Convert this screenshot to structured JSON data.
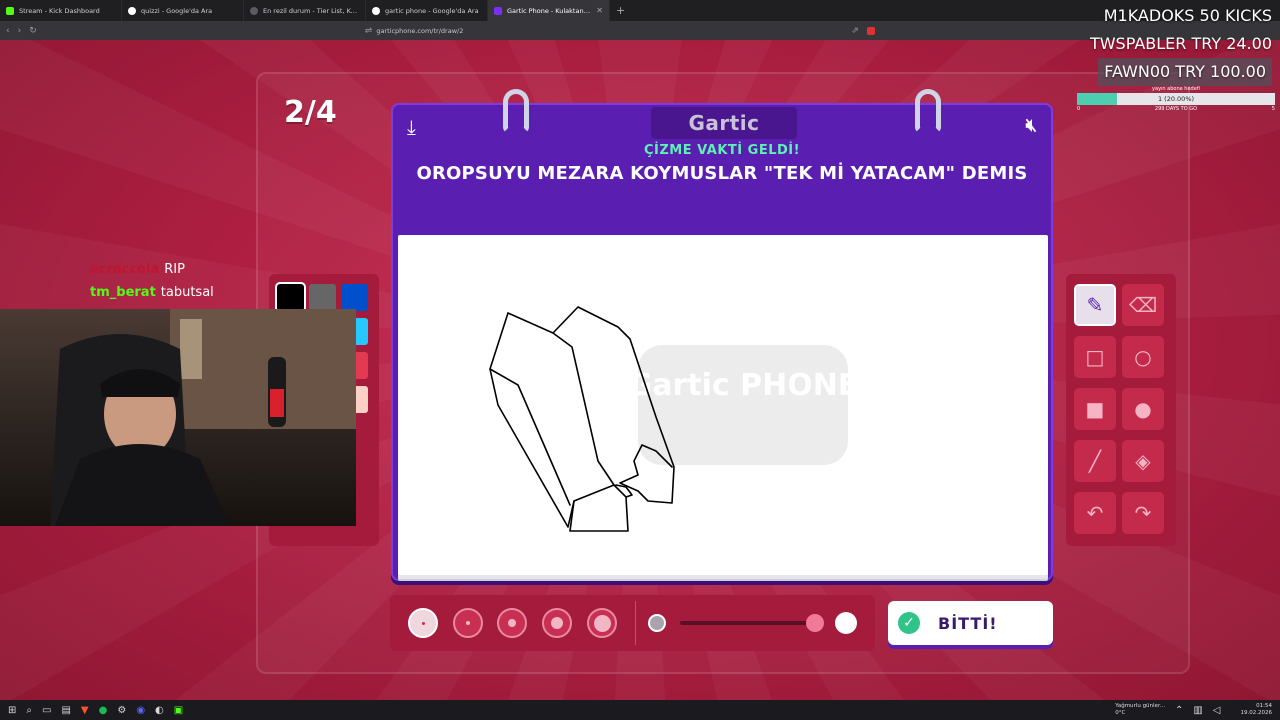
{
  "browser": {
    "tabs": [
      {
        "title": "Stream - Kick Dashboard",
        "icon": "kick-icon",
        "active": false
      },
      {
        "title": "quizzi - Google'da Ara",
        "icon": "google-icon",
        "active": false
      },
      {
        "title": "En rezil durum - Tier List, Kör Seale",
        "icon": "tier-icon",
        "active": false
      },
      {
        "title": "gartic phone - Google'da Ara",
        "icon": "google-icon",
        "active": false
      },
      {
        "title": "Gartic Phone - Kulaktan Kulağa",
        "icon": "gartic-icon",
        "active": true
      }
    ],
    "url": "garticphone.com/tr/draw/2"
  },
  "game": {
    "round": "2/4",
    "brand": "Gartic",
    "draw_time": "ÇİZME VAKTİ GELDİ!",
    "prompt": "OROPSUYU MEZARA KOYMUSLAR \"TEK Mİ YATACAM\" DEMIS",
    "done_label": "BİTTİ!",
    "watermark": "Gartic PHONE",
    "accent": "#5a1fb0",
    "palette": [
      "#000000",
      "#666666",
      "#0050cd",
      "#ffffff",
      "#aaaaaa",
      "#26c9ff",
      "#c0481a",
      "#ff7a00",
      "#e23a52",
      "#ff9a8a",
      "#e85f6a",
      "#fbd0c5"
    ],
    "selected_color": "#000000",
    "tools": [
      "pencil-icon",
      "eraser-icon",
      "rectangle-outline-icon",
      "circle-outline-icon",
      "rectangle-fill-icon",
      "circle-fill-icon",
      "line-icon",
      "fill-bucket-icon",
      "undo-icon",
      "redo-icon"
    ],
    "selected_tool": "pencil-icon",
    "brush_sizes": 5,
    "selected_size_index": 0
  },
  "overlay": {
    "chat": [
      {
        "user": "acraccola",
        "color": "#c01530",
        "message": "RIP"
      },
      {
        "user": "tm_berat",
        "color": "#53fc18",
        "message": "tabutsal"
      }
    ],
    "donations": [
      {
        "text": "M1KADOKS  50 KICKS"
      },
      {
        "text": "TWSPABLER  TRY 24.00"
      },
      {
        "text": "FAWN00  TRY 100.00"
      }
    ],
    "subgoal": {
      "title": "yayın abone hedefi",
      "progress_text": "1 (20.00%)",
      "progress": 0.2,
      "min": "0",
      "max": "5",
      "days": "299 DAYS TO GO"
    }
  },
  "taskbar": {
    "weather": "Yağmurlu günler...",
    "temp": "0°C",
    "time": "01:54",
    "date": "19.02.2026"
  }
}
